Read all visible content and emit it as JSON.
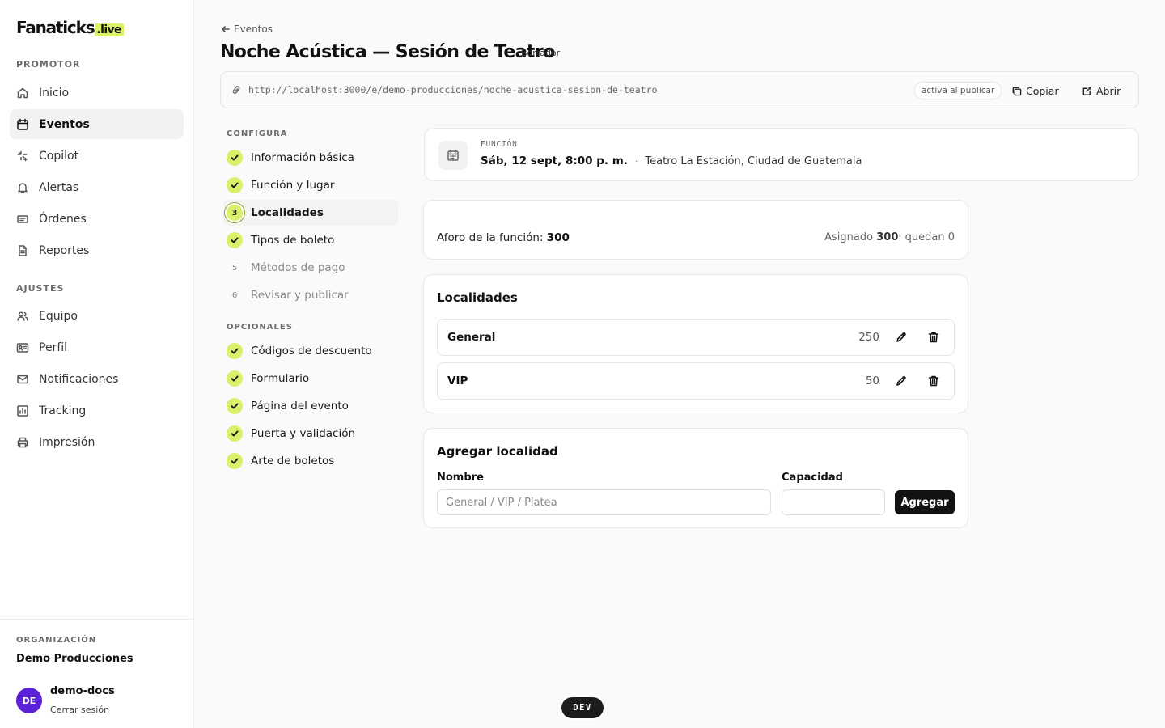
{
  "brand": {
    "name": "Fanaticks",
    "suffix": ".live",
    "accent": "#d9f26a"
  },
  "sidebar": {
    "sections": [
      "PROMOTOR",
      "AJUSTES"
    ],
    "items": [
      {
        "label": "Inicio",
        "icon": "home-icon"
      },
      {
        "label": "Eventos",
        "icon": "calendar-icon",
        "active": true
      },
      {
        "label": "Copilot",
        "icon": "sparkle-icon"
      },
      {
        "label": "Alertas",
        "icon": "bell-icon"
      },
      {
        "label": "Órdenes",
        "icon": "ticket-icon"
      },
      {
        "label": "Reportes",
        "icon": "document-icon"
      },
      {
        "label": "Equipo",
        "icon": "users-icon"
      },
      {
        "label": "Perfil",
        "icon": "id-card-icon"
      },
      {
        "label": "Notificaciones",
        "icon": "mail-icon"
      },
      {
        "label": "Tracking",
        "icon": "chart-icon"
      },
      {
        "label": "Impresión",
        "icon": "printer-icon"
      }
    ],
    "org": {
      "label": "ORGANIZACIÓN",
      "name": "Demo Producciones"
    },
    "user": {
      "initials": "DE",
      "name": "demo-docs",
      "logout": "Cerrar sesión",
      "avatar_color": "#5b21d6"
    }
  },
  "header": {
    "back": "Eventos",
    "title": "Noche Acústica — Sesión de Teatro",
    "status": "Borrador",
    "url": "http://localhost:3000/e/demo-producciones/noche-acustica-sesion-de-teatro",
    "url_pill": "activa al publicar",
    "copy": "Copiar",
    "open": "Abrir"
  },
  "stepper": {
    "configura": "CONFIGURA",
    "opcionales": "OPCIONALES",
    "steps": [
      {
        "label": "Información básica",
        "state": "done"
      },
      {
        "label": "Función y lugar",
        "state": "done"
      },
      {
        "label": "Localidades",
        "state": "current",
        "number": "3"
      },
      {
        "label": "Tipos de boleto",
        "state": "done"
      },
      {
        "label": "Métodos de pago",
        "state": "pending",
        "number": "5"
      },
      {
        "label": "Revisar y publicar",
        "state": "pending",
        "number": "6"
      }
    ],
    "optional": [
      {
        "label": "Códigos de descuento",
        "state": "done"
      },
      {
        "label": "Formulario",
        "state": "done"
      },
      {
        "label": "Página del evento",
        "state": "done"
      },
      {
        "label": "Puerta y validación",
        "state": "done"
      },
      {
        "label": "Arte de boletos",
        "state": "done"
      }
    ]
  },
  "funcion": {
    "label": "FUNCIÓN",
    "date": "Sáb, 12 sept, 8:00 p. m.",
    "separator": "·",
    "venue": "Teatro La Estación, Ciudad de Guatemala"
  },
  "capacity": {
    "label": "Aforo de la función:",
    "value": "300",
    "assigned_label": "Asignado",
    "assigned": "300",
    "remaining": "· quedan 0"
  },
  "localidades": {
    "title": "Localidades",
    "rows": [
      {
        "name": "General",
        "capacity": "250"
      },
      {
        "name": "VIP",
        "capacity": "50"
      }
    ]
  },
  "add_form": {
    "title": "Agregar localidad",
    "name_label": "Nombre",
    "name_placeholder": "General / VIP / Platea",
    "capacity_label": "Capacidad",
    "capacity_value": "",
    "submit": "Agregar"
  },
  "dev_badge": "DEV"
}
